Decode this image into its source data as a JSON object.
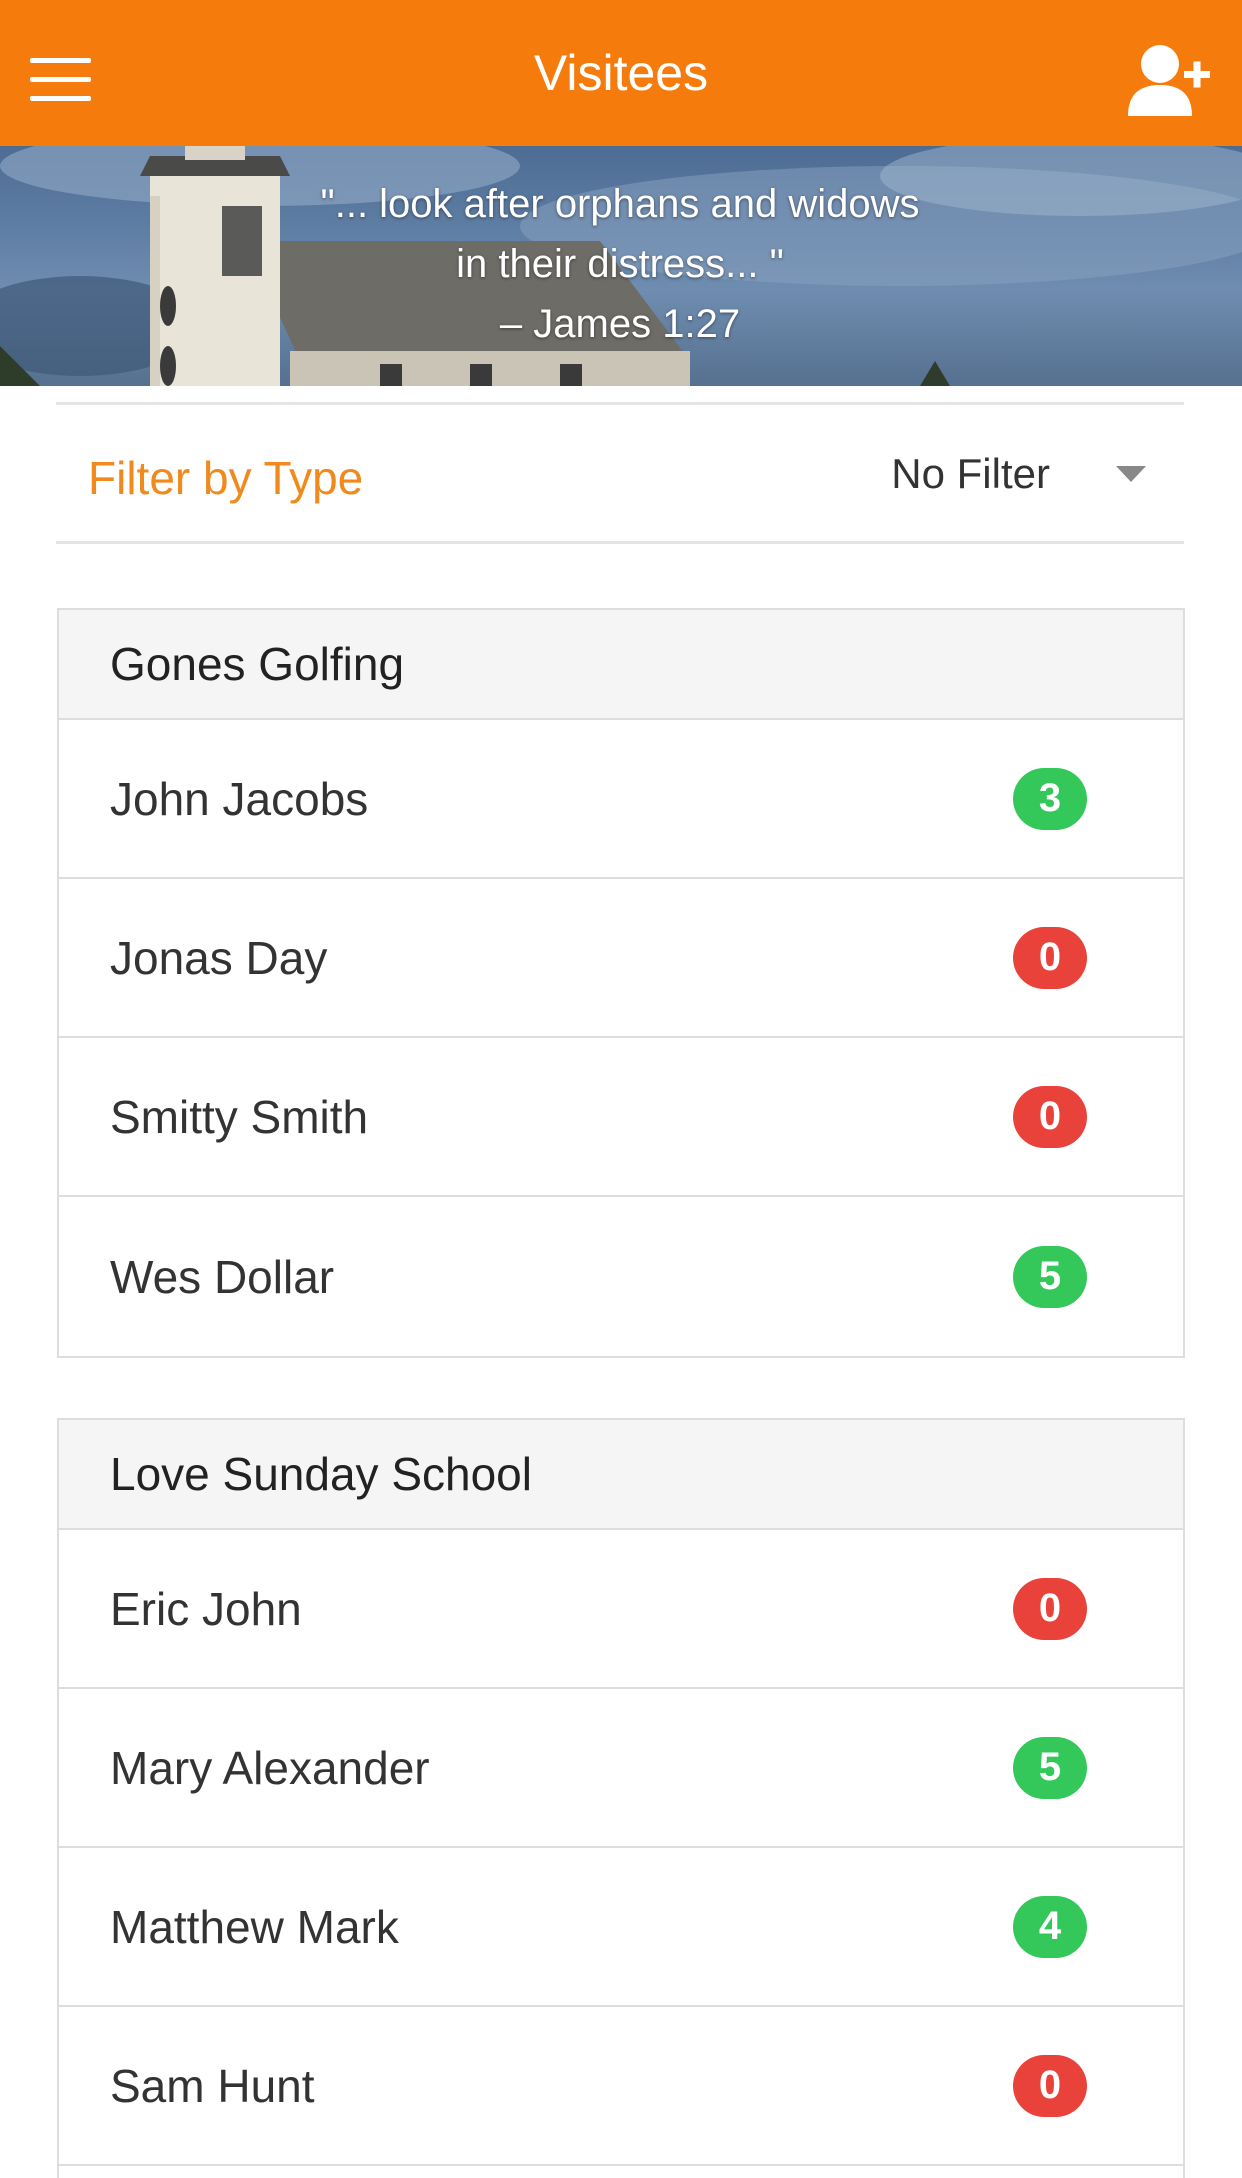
{
  "header": {
    "title": "Visitees",
    "menu_icon": "hamburger-menu-icon",
    "add_icon": "add-user-icon",
    "color": "#f57c0c"
  },
  "banner": {
    "quote_line1": "\"... look after orphans and widows",
    "quote_line2": "in their distress... \"",
    "citation": "– James 1:27"
  },
  "filter": {
    "label": "Filter by Type",
    "selected": "No Filter"
  },
  "colors": {
    "badge_positive": "#34c759",
    "badge_zero": "#e8423a",
    "accent": "#f08a1c"
  },
  "groups": [
    {
      "name": "Gones Golfing",
      "members": [
        {
          "name": "John Jacobs",
          "count": "3"
        },
        {
          "name": "Jonas Day",
          "count": "0"
        },
        {
          "name": "Smitty Smith",
          "count": "0"
        },
        {
          "name": "Wes Dollar",
          "count": "5"
        }
      ]
    },
    {
      "name": "Love Sunday School",
      "members": [
        {
          "name": "Eric John",
          "count": "0"
        },
        {
          "name": "Mary Alexander",
          "count": "5"
        },
        {
          "name": "Matthew Mark",
          "count": "4"
        },
        {
          "name": "Sam Hunt",
          "count": "0"
        }
      ]
    }
  ]
}
